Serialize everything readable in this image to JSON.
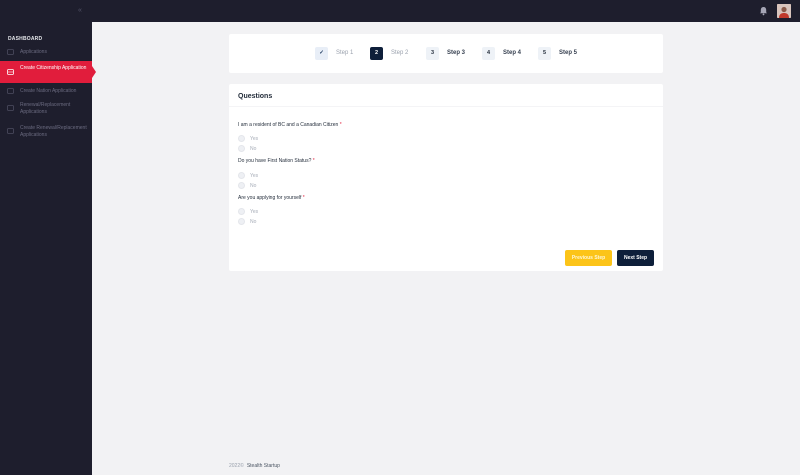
{
  "sidebar": {
    "section_title": "DASHBOARD",
    "items": [
      {
        "label": "Applications",
        "icon": "document-icon",
        "active": false
      },
      {
        "label": "Create Citizenship Application",
        "icon": "document-icon",
        "active": true
      },
      {
        "label": "Create Nation Application",
        "icon": "document-icon",
        "active": false
      },
      {
        "label": "Renewal/Replacement Applications",
        "icon": "document-icon",
        "active": false
      },
      {
        "label": "Create Renewal/Replacement Applications",
        "icon": "document-icon",
        "active": false
      }
    ]
  },
  "steps": [
    {
      "number": "✓",
      "label": "Step 1",
      "state": "completed"
    },
    {
      "number": "2",
      "label": "Step 2",
      "state": "current"
    },
    {
      "number": "3",
      "label": "Step 3",
      "state": "upcoming"
    },
    {
      "number": "4",
      "label": "Step 4",
      "state": "upcoming"
    },
    {
      "number": "5",
      "label": "Step 5",
      "state": "upcoming"
    }
  ],
  "form": {
    "title": "Questions",
    "questions": [
      {
        "label": "I am a resident of BC and a Canadian Citizen",
        "required": "*",
        "options": [
          "Yes",
          "No"
        ]
      },
      {
        "label": "Do you have First Nation Status?",
        "required": "*",
        "options": [
          "Yes",
          "No"
        ]
      },
      {
        "label": "Are you applying for yourself",
        "required": "*",
        "options": [
          "Yes",
          "No"
        ]
      }
    ],
    "previous_label": "Previous Step",
    "next_label": "Next Step"
  },
  "footer": {
    "year": "2022©",
    "brand": "Stealth Startup"
  },
  "colors": {
    "accent": "#e11d3c",
    "navy": "#0e1f3a",
    "sidebar": "#1e1e2d",
    "warning": "#fcc419"
  }
}
